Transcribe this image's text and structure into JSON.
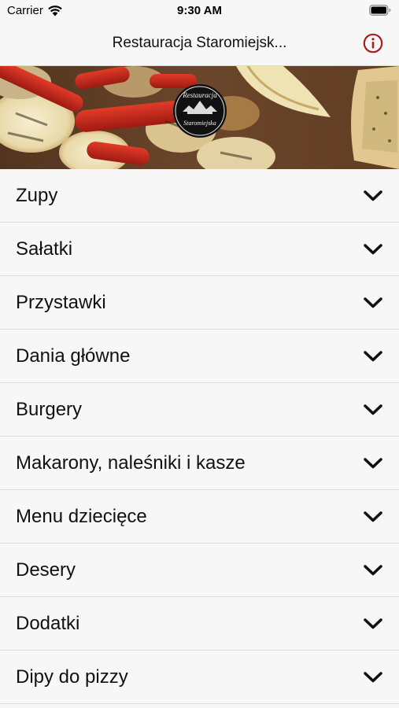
{
  "status_bar": {
    "carrier": "Carrier",
    "time": "9:30 AM"
  },
  "nav": {
    "title": "Restauracja Staromiejsk...",
    "info_icon": "info-circle-icon",
    "accent_color": "#a61e1e"
  },
  "banner": {
    "logo_line1": "Restauracja",
    "logo_line2": "Staromiejska"
  },
  "menu": {
    "chevron_icon": "chevron-down-icon",
    "items": [
      {
        "label": "Zupy"
      },
      {
        "label": "Sałatki"
      },
      {
        "label": "Przystawki"
      },
      {
        "label": "Dania główne"
      },
      {
        "label": "Burgery"
      },
      {
        "label": "Makarony, naleśniki i kasze"
      },
      {
        "label": "Menu dziecięce"
      },
      {
        "label": "Desery"
      },
      {
        "label": "Dodatki"
      },
      {
        "label": "Dipy do pizzy"
      }
    ]
  }
}
